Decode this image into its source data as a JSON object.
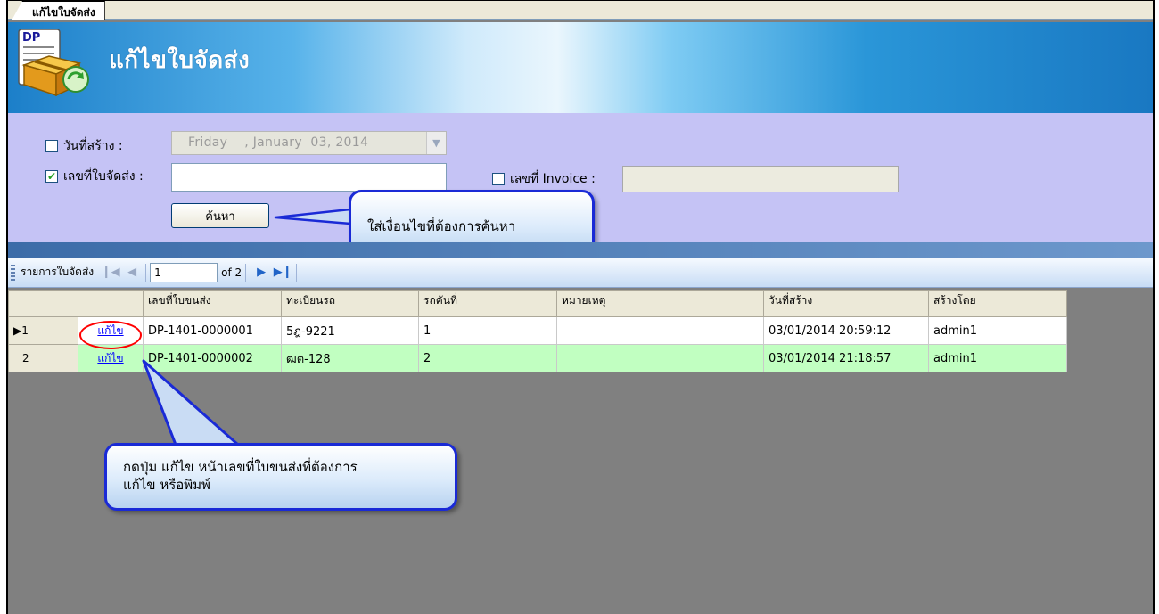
{
  "tab": {
    "label": "แก้ไขใบจัดส่ง"
  },
  "banner": {
    "title": "แก้ไขใบจัดส่ง",
    "logo_text": "DP"
  },
  "search": {
    "created_date_label": "วันที่สร้าง :",
    "created_date_checked": false,
    "created_date_value": "Friday    , January  03, 2014",
    "delivery_no_label": "เลขที่ใบจัดส่ง :",
    "delivery_no_checked": true,
    "delivery_no_value": "",
    "invoice_label": "เลขที่ Invoice :",
    "invoice_checked": false,
    "invoice_value": "",
    "search_button": "ค้นหา"
  },
  "callouts": {
    "search_hint": "ใส่เงื่อนไขที่ต้องการค้นหา",
    "edit_hint_line1": "กดปุ่ม แก้ไข หน้าเลขที่ใบขนส่งที่ต้องการ",
    "edit_hint_line2": "แก้ไข หรือพิมพ์"
  },
  "navigator": {
    "label": "รายการใบจัดส่ง",
    "position": "1",
    "of_text": "of 2"
  },
  "grid": {
    "columns": [
      "",
      "เลขที่ใบขนส่ง",
      "ทะเบียนรถ",
      "รถคันที่",
      "หมายเหตุ",
      "วันที่สร้าง",
      "สร้างโดย"
    ],
    "rows": [
      {
        "row_header": "1",
        "action": "แก้ไข",
        "doc_no": "DP-1401-0000001",
        "plate": "5ฎ-9221",
        "car_no": "1",
        "note": "",
        "created": "03/01/2014 20:59:12",
        "by": "admin1"
      },
      {
        "row_header": "2",
        "action": "แก้ไข",
        "doc_no": "DP-1401-0000002",
        "plate": "ฒต-128",
        "car_no": "2",
        "note": "",
        "created": "03/01/2014 21:18:57",
        "by": "admin1"
      }
    ]
  },
  "colors": {
    "alt_row": "#c1ffc1",
    "search_panel": "#c5c3f5",
    "grid_empty": "#808080",
    "callout_border": "#1a2ad6",
    "highlight": "#ff0000"
  }
}
